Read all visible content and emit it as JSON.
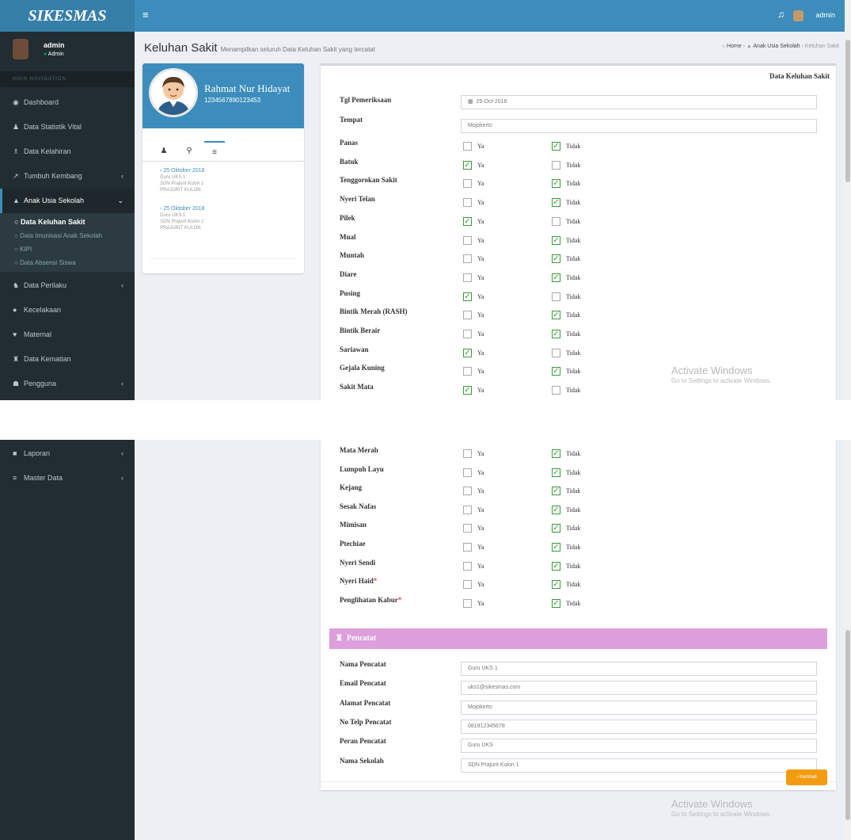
{
  "app": {
    "brand": "SIKESMAS",
    "top_user": "admin"
  },
  "user_panel": {
    "name": "admin",
    "status": "Admin"
  },
  "nav_header": "MAIN NAVIGATION",
  "menu_top": [
    {
      "icon": "dashboard-icon",
      "glyph": "◉",
      "label": "Dashboard",
      "arrow": ""
    },
    {
      "icon": "person-icon",
      "glyph": "♟",
      "label": "Data Statistik Vital",
      "arrow": ""
    },
    {
      "icon": "baby-icon",
      "glyph": "♗",
      "label": "Data Kelahiran",
      "arrow": ""
    },
    {
      "icon": "line-chart-icon",
      "glyph": "↗",
      "label": "Tumbuh Kembang",
      "arrow": "‹"
    },
    {
      "icon": "graduation-cap-icon",
      "glyph": "▲",
      "label": "Anak Usia Sekolah",
      "arrow": "⌄"
    }
  ],
  "submenu": [
    {
      "label": "Data Keluhan Sakit",
      "current": true
    },
    {
      "label": "Data Imunisasi Anak Sekolah",
      "current": false
    },
    {
      "label": "KIPI",
      "current": false
    },
    {
      "label": "Data Absensi Siswa",
      "current": false
    }
  ],
  "menu_bottom": [
    {
      "icon": "users-icon",
      "glyph": "♞",
      "label": "Data Perilaku",
      "arrow": "‹"
    },
    {
      "icon": "info-icon",
      "glyph": "●",
      "label": "Kecelakaan",
      "arrow": ""
    },
    {
      "icon": "heart-icon",
      "glyph": "♥",
      "label": "Maternal",
      "arrow": ""
    },
    {
      "icon": "user-group-icon",
      "glyph": "♜",
      "label": "Data Kematian",
      "arrow": ""
    },
    {
      "icon": "users-cog-icon",
      "glyph": "☗",
      "label": "Pengguna",
      "arrow": "‹"
    }
  ],
  "menu_second": [
    {
      "icon": "file-report-icon",
      "glyph": "■",
      "label": "Laporan",
      "arrow": "‹"
    },
    {
      "icon": "database-icon",
      "glyph": "≡",
      "label": "Master Data",
      "arrow": "‹"
    }
  ],
  "page": {
    "title": "Keluhan Sakit",
    "subtitle": "Menampilkan seluruh Data Keluhan Sakit yang tercatat"
  },
  "breadcrumb": {
    "home": "Home",
    "section": "Anak Usia Sekolah",
    "current": "Keluhan Sakit"
  },
  "profile": {
    "name": "Rahmat Nur Hidayat",
    "nik": "1234567890123453"
  },
  "history": [
    {
      "date": "25 Oktober 2018",
      "line1": "Guru UKS 1",
      "line2": "SDN Prajurit Kulon 1",
      "line3": "PRAJURIT KULON"
    },
    {
      "date": "25 Oktober 2018",
      "line1": "Guru UKS 1",
      "line2": "SDN Prajurit Kulon 1",
      "line3": "PRAJURIT KULON"
    }
  ],
  "card_title": "Data Keluhan Sakit",
  "fields": {
    "tgl": {
      "label": "Tgl Pemeriksaan",
      "value": "25-Oct-2018"
    },
    "tempat": {
      "label": "Tempat",
      "value": "Mojokerto"
    }
  },
  "opt": {
    "ya": "Ya",
    "tidak": "Tidak"
  },
  "symptoms": [
    {
      "label": "Panas",
      "ya": false,
      "tidak": true
    },
    {
      "label": "Batuk",
      "ya": true,
      "tidak": false
    },
    {
      "label": "Tenggorokan Sakit",
      "ya": false,
      "tidak": true
    },
    {
      "label": "Nyeri Telan",
      "ya": false,
      "tidak": true
    },
    {
      "label": "Pilek",
      "ya": true,
      "tidak": false
    },
    {
      "label": "Mual",
      "ya": false,
      "tidak": true
    },
    {
      "label": "Muntah",
      "ya": false,
      "tidak": true
    },
    {
      "label": "Diare",
      "ya": false,
      "tidak": true
    },
    {
      "label": "Pusing",
      "ya": true,
      "tidak": false
    },
    {
      "label": "Bintik Merah (RASH)",
      "ya": false,
      "tidak": true
    },
    {
      "label": "Bintik Berair",
      "ya": false,
      "tidak": true
    },
    {
      "label": "Sariawan",
      "ya": true,
      "tidak": false
    },
    {
      "label": "Gejala Kuning",
      "ya": false,
      "tidak": true
    },
    {
      "label": "Sakit Mata",
      "ya": true,
      "tidak": false
    }
  ],
  "symptoms2": [
    {
      "label": "Mata Merah",
      "req": "",
      "ya": false,
      "tidak": true
    },
    {
      "label": "Lumpuh Layu",
      "req": "",
      "ya": false,
      "tidak": true
    },
    {
      "label": "Kejang",
      "req": "",
      "ya": false,
      "tidak": true
    },
    {
      "label": "Sesak Nafas",
      "req": "",
      "ya": false,
      "tidak": true
    },
    {
      "label": "Mimisan",
      "req": "",
      "ya": false,
      "tidak": true
    },
    {
      "label": "Ptechiae",
      "req": "",
      "ya": false,
      "tidak": true
    },
    {
      "label": "Nyeri Sendi",
      "req": "",
      "ya": false,
      "tidak": true
    },
    {
      "label": "Nyeri Haid",
      "req": "*",
      "ya": false,
      "tidak": true
    },
    {
      "label": "Penglihatan Kabur",
      "req": "*",
      "ya": false,
      "tidak": true
    }
  ],
  "pencatat_title": "Pencatat",
  "pencatat": [
    {
      "label": "Nama Pencatat",
      "value": "Guru UKS 1"
    },
    {
      "label": "Email Pencatat",
      "value": "uks1@sikesmas.com"
    },
    {
      "label": "Alamat Pencatat",
      "value": "Mojokerto"
    },
    {
      "label": "No Telp Pencatat",
      "value": "081912345678"
    },
    {
      "label": "Peran Pencatat",
      "value": "Guru UKS"
    },
    {
      "label": "Nama Sekolah",
      "value": "SDN Prajurit Kulon 1"
    }
  ],
  "back_button": "Kembali",
  "watermark": {
    "title": "Activate Windows",
    "sub": "Go to Settings to activate Windows."
  }
}
